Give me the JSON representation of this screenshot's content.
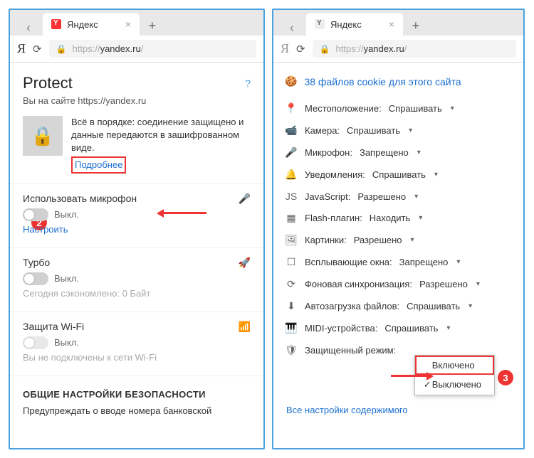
{
  "tabs": {
    "title": "Яндекс",
    "newtab": "+"
  },
  "addr": {
    "logo": "Я",
    "scheme": "https://",
    "host": "yandex.ru",
    "path": "/"
  },
  "left": {
    "title": "Protect",
    "help": "?",
    "subline": "Вы на сайте https://yandex.ru",
    "status_text": "Всё в порядке: соединение защищено и данные передаются в зашифрованном виде.",
    "details": "Подробнее",
    "step2": "2",
    "mic": {
      "title": "Использовать микрофон",
      "state": "Выкл.",
      "configure": "Настроить"
    },
    "turbo": {
      "title": "Турбо",
      "state": "Выкл.",
      "saved": "Сегодня сэкономлено: 0 Байт"
    },
    "wifi": {
      "title": "Защита Wi-Fi",
      "state": "Выкл.",
      "note": "Вы не подключены к сети Wi-Fi"
    },
    "section_head": "ОБЩИЕ НАСТРОЙКИ БЕЗОПАСНОСТИ",
    "section_sub": "Предупреждать о вводе номера банковской"
  },
  "right": {
    "cookie_count": "38 файлов cookie для этого сайта",
    "perms": [
      {
        "icon": "📍",
        "name": "location-icon",
        "label": "Местоположение:",
        "value": "Спрашивать"
      },
      {
        "icon": "📹",
        "name": "camera-icon",
        "label": "Камера:",
        "value": "Спрашивать"
      },
      {
        "icon": "🎤",
        "name": "microphone-icon",
        "label": "Микрофон:",
        "value": "Запрещено"
      },
      {
        "icon": "🔔",
        "name": "notifications-icon",
        "label": "Уведомления:",
        "value": "Спрашивать"
      },
      {
        "icon": "JS",
        "name": "javascript-icon",
        "label": "JavaScript:",
        "value": "Разрешено"
      },
      {
        "icon": "▦",
        "name": "flash-icon",
        "label": "Flash-плагин:",
        "value": "Находить"
      },
      {
        "icon": "🖼",
        "name": "images-icon",
        "label": "Картинки:",
        "value": "Разрешено"
      },
      {
        "icon": "☐",
        "name": "popups-icon",
        "label": "Всплывающие окна:",
        "value": "Запрещено"
      },
      {
        "icon": "⟳",
        "name": "background-sync-icon",
        "label": "Фоновая синхронизация:",
        "value": "Разрешено"
      },
      {
        "icon": "⬇",
        "name": "autodownload-icon",
        "label": "Автозагрузка файлов:",
        "value": "Спрашивать"
      },
      {
        "icon": "🎹",
        "name": "midi-icon",
        "label": "MIDI-устройства:",
        "value": "Спрашивать"
      },
      {
        "icon": "🛡",
        "name": "protected-mode-icon",
        "label": "Защищенный режим:",
        "value": ""
      }
    ],
    "dropdown": {
      "on": "Включено",
      "off": "Выключено"
    },
    "step3": "3",
    "all_settings": "Все настройки содержимого"
  }
}
